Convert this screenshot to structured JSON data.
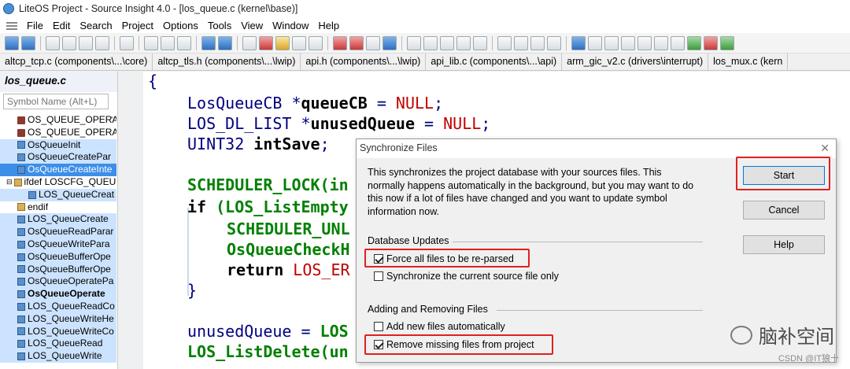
{
  "window": {
    "title": "LiteOS Project - Source Insight 4.0 - [los_queue.c (kernel\\base)]"
  },
  "menu": [
    "File",
    "Edit",
    "Search",
    "Project",
    "Options",
    "Tools",
    "View",
    "Window",
    "Help"
  ],
  "tabs": [
    "altcp_tcp.c (components\\...\\core)",
    "altcp_tls.h (components\\...\\lwip)",
    "api.h (components\\...\\lwip)",
    "api_lib.c (components\\...\\api)",
    "arm_gic_v2.c (drivers\\interrupt)",
    "los_mux.c (kern"
  ],
  "symbol_panel": {
    "title": "los_queue.c",
    "search_placeholder": "Symbol Name (Alt+L)",
    "items": [
      {
        "label": "OS_QUEUE_OPERAT",
        "icon": "hash-icon"
      },
      {
        "label": "OS_QUEUE_OPERAT",
        "icon": "hash-icon"
      },
      {
        "label": "OsQueueInit",
        "icon": "function-icon"
      },
      {
        "label": "OsQueueCreatePar",
        "icon": "function-icon"
      },
      {
        "label": "OsQueueCreateInte",
        "icon": "function-icon"
      },
      {
        "label": "ifdef LOSCFG_QUEU",
        "icon": "conditional-icon"
      },
      {
        "label": "LOS_QueueCreat",
        "icon": "function-icon"
      },
      {
        "label": "endif",
        "icon": "conditional-icon"
      },
      {
        "label": "LOS_QueueCreate",
        "icon": "function-icon"
      },
      {
        "label": "OsQueueReadParar",
        "icon": "function-icon"
      },
      {
        "label": "OsQueueWritePara",
        "icon": "function-icon"
      },
      {
        "label": "OsQueueBufferOpe",
        "icon": "function-icon"
      },
      {
        "label": "OsQueueBufferOpe",
        "icon": "function-icon"
      },
      {
        "label": "OsQueueOperatePa",
        "icon": "function-icon"
      },
      {
        "label": "OsQueueOperate",
        "icon": "function-icon"
      },
      {
        "label": "LOS_QueueReadCo",
        "icon": "function-icon"
      },
      {
        "label": "LOS_QueueWriteHe",
        "icon": "function-icon"
      },
      {
        "label": "LOS_QueueWriteCo",
        "icon": "function-icon"
      },
      {
        "label": "LOS_QueueRead",
        "icon": "function-icon"
      },
      {
        "label": "LOS_QueueWrite",
        "icon": "function-icon"
      }
    ]
  },
  "code": {
    "line1": "{",
    "line2_type": "LosQueueCB *",
    "line2_var": "queueCB",
    "line2_eq": " = ",
    "line2_val": "NULL",
    "line2_end": ";",
    "line3_type": "LOS_DL_LIST *",
    "line3_var": "unusedQueue",
    "line3_eq": " = ",
    "line3_val": "NULL",
    "line3_end": ";",
    "line4_type": "UINT32 ",
    "line4_var": "intSave",
    "line4_end": ";",
    "line5": "SCHEDULER_LOCK(in",
    "line6_kw": "if ",
    "line6_rest": "(LOS_ListEmpty",
    "line7": "SCHEDULER_UNL",
    "line8": "OsQueueCheckH",
    "line9_kw": "return ",
    "line9_val": "LOS_ER",
    "line10": "}",
    "line11_a": "unusedQueue = ",
    "line11_b": "LOS",
    "line12": "LOS_ListDelete(un"
  },
  "dialog": {
    "title": "Synchronize Files",
    "description": "This synchronizes the project database with your sources files. This normally happens automatically in the background, but you may want to do this now if a lot of files have changed and you want to update symbol information now.",
    "group1": "Database Updates",
    "force_reparse": "Force all files to be re-parsed",
    "sync_current": "Synchronize the current source file only",
    "group2": "Adding and Removing Files",
    "add_new": "Add new files automatically",
    "remove_missing": "Remove missing files from project",
    "start": "Start",
    "cancel": "Cancel",
    "help": "Help"
  },
  "watermark": {
    "text": "脑补空间",
    "csdn": "CSDN @IT狼十"
  },
  "colors": {
    "highlight": "#e02020",
    "keyword": "#008000",
    "type": "#000080",
    "literal": "#c00000"
  }
}
